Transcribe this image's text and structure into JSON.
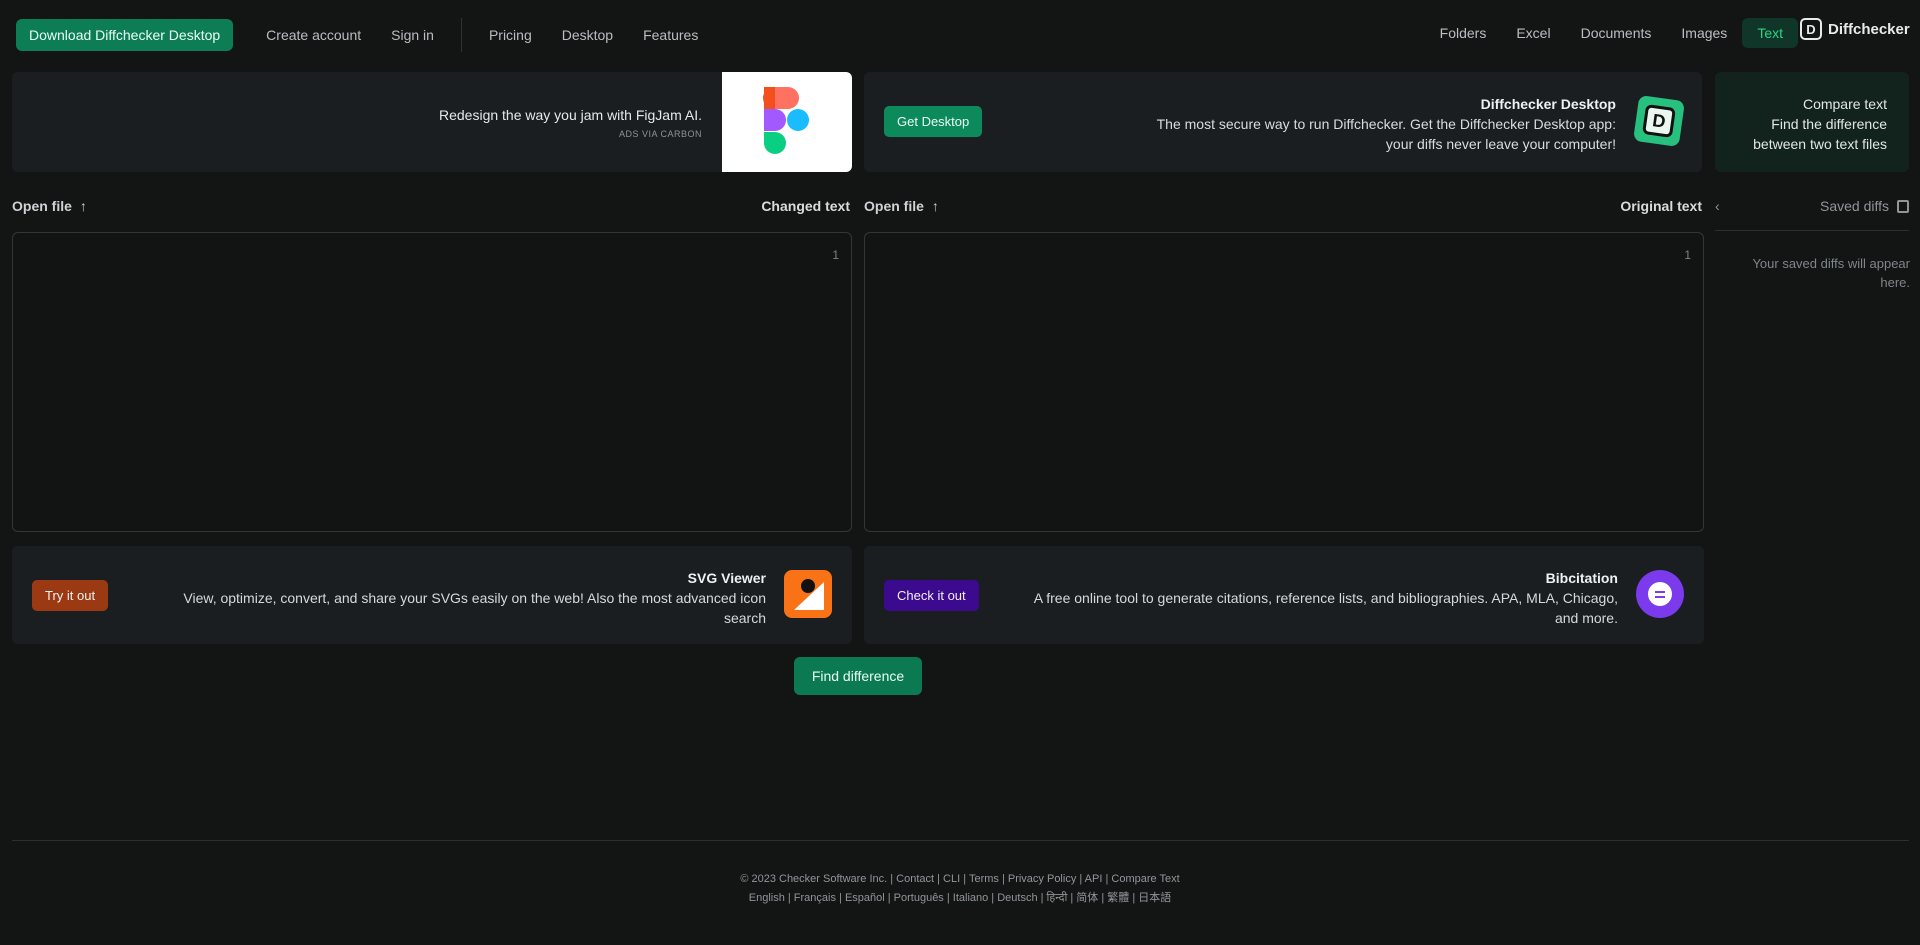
{
  "header": {
    "logo_letter": "D",
    "logo_text": "Diffchecker",
    "nav_tabs": [
      "Text",
      "Images",
      "Documents",
      "Excel",
      "Folders"
    ],
    "active_tab": "Text",
    "links": [
      "Features",
      "Desktop",
      "Pricing"
    ],
    "sign_in": "Sign in",
    "create_account": "Create account",
    "download_button": "Download Diffchecker Desktop"
  },
  "compare_card": {
    "line1": "Compare text",
    "line2": "Find the difference",
    "line3": "between two text files"
  },
  "promo": {
    "title": "Diffchecker Desktop",
    "body": "The most secure way to run Diffchecker. Get the Diffchecker Desktop app: your diffs never leave your computer!",
    "button": "Get Desktop"
  },
  "ad": {
    "title": "Redesign the way you jam with FigJam AI.",
    "via": "ADS VIA CARBON"
  },
  "saved": {
    "title": "Saved diffs",
    "empty": "Your saved diffs will appear here."
  },
  "original": {
    "label": "Original text",
    "open_file": "Open file",
    "line_number": "1"
  },
  "changed": {
    "label": "Changed text",
    "open_file": "Open file",
    "line_number": "1"
  },
  "tools": {
    "bibcitation": {
      "title": "Bibcitation",
      "body": "A free online tool to generate citations, reference lists, and bibliographies. APA, MLA, Chicago, and more.",
      "button": "Check it out",
      "color": "#3b0a8f"
    },
    "svgviewer": {
      "title": "SVG Viewer",
      "body": "View, optimize, convert, and share your SVGs easily on the web! Also the most advanced icon search",
      "button": "Try it out",
      "color": "#9b3a12"
    }
  },
  "find_button": "Find difference",
  "footer": {
    "line1": "© 2023 Checker Software Inc. | Contact | CLI | Terms | Privacy Policy | API | Compare Text",
    "line2": "English | Français | Español | Português | Italiano | Deutsch | हिन्दी | 简体 | 繁體 | 日本語"
  }
}
